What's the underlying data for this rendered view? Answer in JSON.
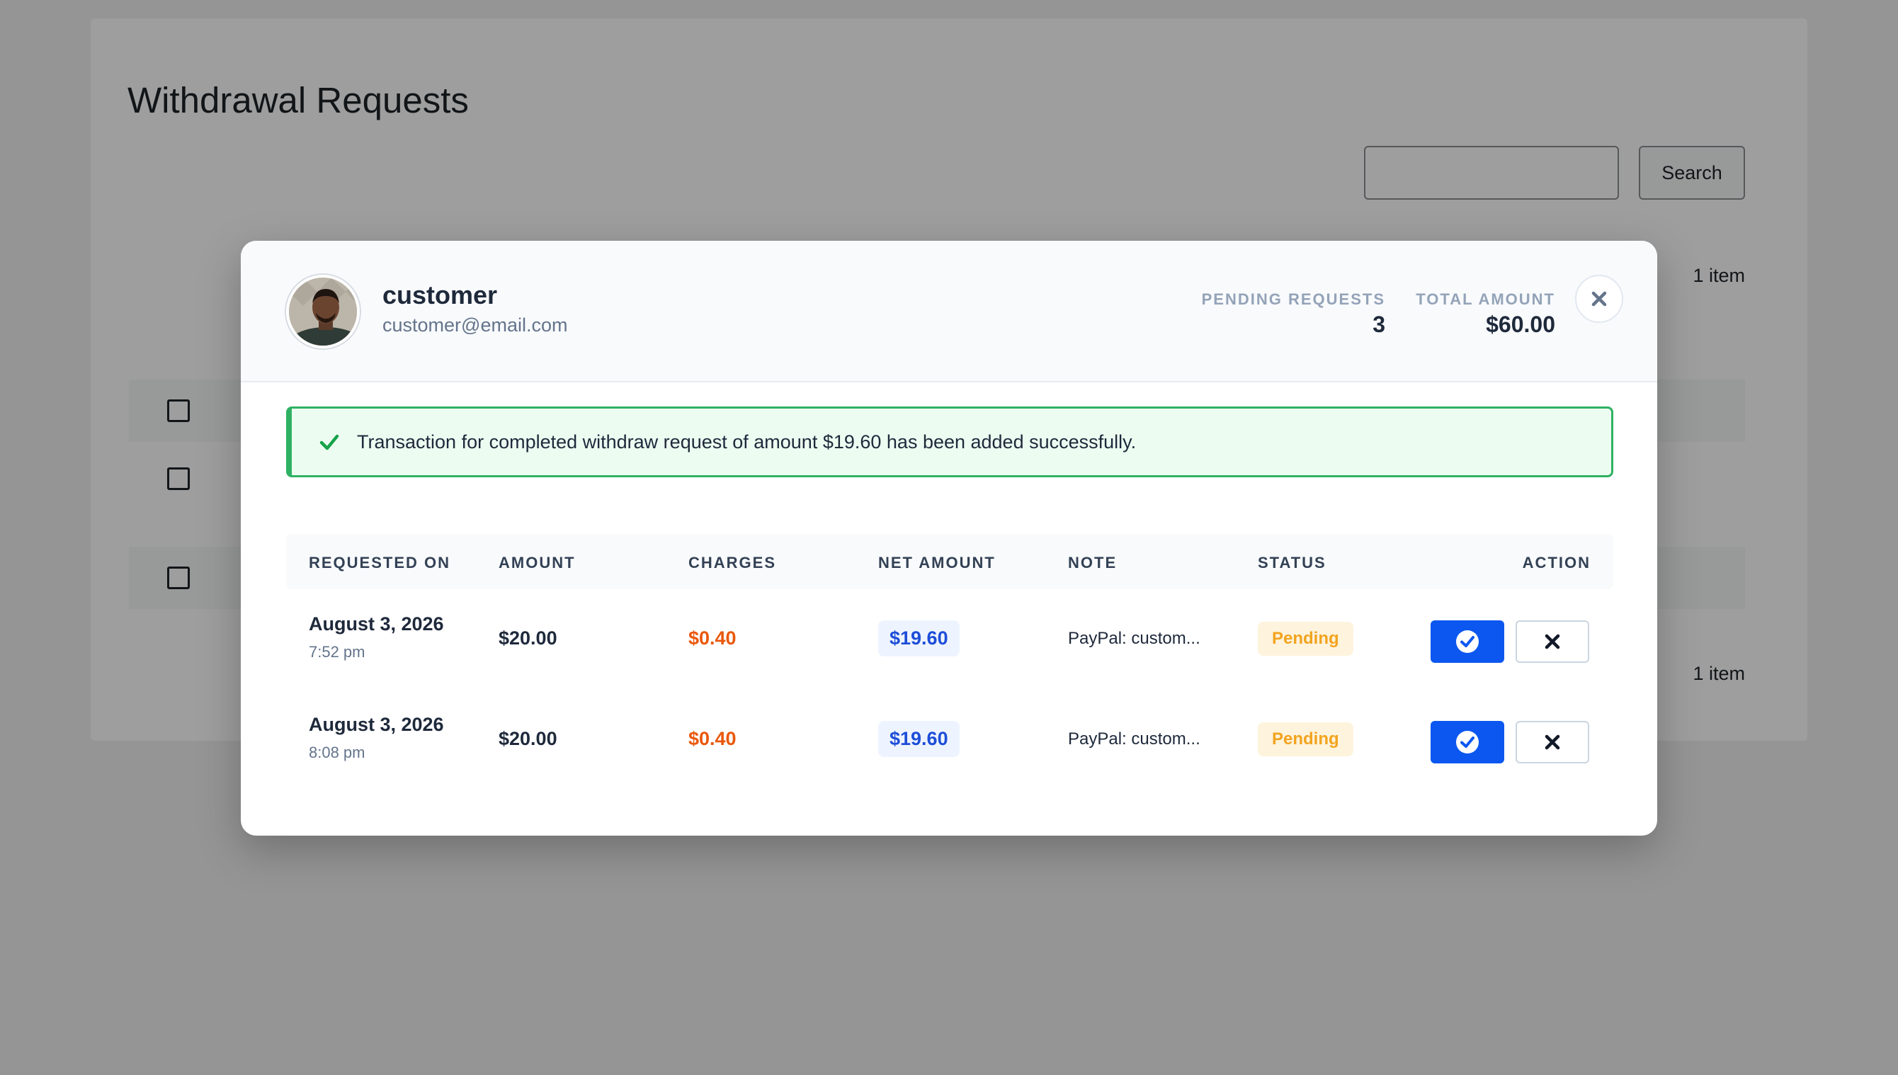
{
  "page": {
    "title": "Withdrawal Requests",
    "search_label": "Search",
    "item_count_top": "1 item",
    "item_count_bottom": "1 item"
  },
  "modal": {
    "user": {
      "name": "customer",
      "email": "customer@email.com"
    },
    "stats": {
      "pending_label": "PENDING REQUESTS",
      "pending_value": "3",
      "total_label": "TOTAL AMOUNT",
      "total_value": "$60.00"
    },
    "alert": {
      "message": "Transaction for completed withdraw request of amount $19.60 has been added successfully."
    },
    "table": {
      "headers": {
        "requested_on": "REQUESTED ON",
        "amount": "AMOUNT",
        "charges": "CHARGES",
        "net_amount": "NET AMOUNT",
        "note": "NOTE",
        "status": "STATUS",
        "action": "ACTION"
      },
      "rows": [
        {
          "date": "August 3, 2026",
          "time": "7:52 pm",
          "amount": "$20.00",
          "charges": "$0.40",
          "net": "$19.60",
          "note": "PayPal: custom...",
          "status": "Pending"
        },
        {
          "date": "August 3, 2026",
          "time": "8:08 pm",
          "amount": "$20.00",
          "charges": "$0.40",
          "net": "$19.60",
          "note": "PayPal: custom...",
          "status": "Pending"
        }
      ]
    }
  },
  "colors": {
    "approve": "#0b57f0",
    "success": "#2fb163",
    "charges": "#ea580c",
    "pending": "#f2a41f"
  },
  "icons": {
    "close": "close-icon",
    "success": "checkmark-icon",
    "approve": "check-circle-icon",
    "reject": "x-icon"
  }
}
